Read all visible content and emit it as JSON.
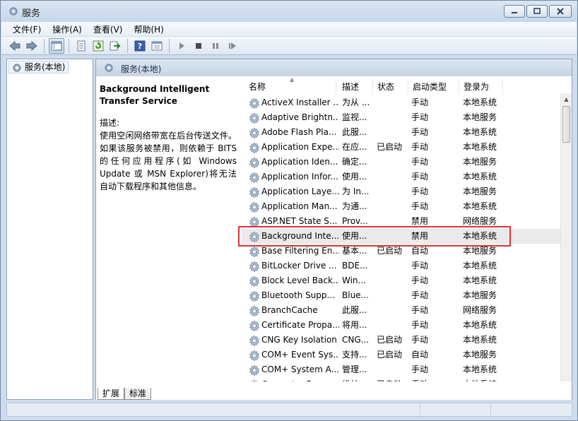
{
  "window": {
    "title": "服务"
  },
  "menu": [
    "文件(F)",
    "操作(A)",
    "查看(V)",
    "帮助(H)"
  ],
  "toolbar": {
    "icons": [
      "back-arrow-icon",
      "forward-arrow-icon",
      "show-tree-icon",
      "properties-icon",
      "refresh-icon",
      "export-icon",
      "help-icon",
      "view-icon",
      "start-icon",
      "stop-icon",
      "pause-icon",
      "restart-icon"
    ]
  },
  "tree": {
    "root": "服务(本地)"
  },
  "pane": {
    "header": "服务(本地)"
  },
  "description": {
    "title": "Background Intelligent Transfer Service",
    "label": "描述:",
    "body": "使用空闲网络带宽在后台传送文件。如果该服务被禁用，则依赖于 BITS 的任何应用程序(如 Windows Update 或 MSN Explorer)将无法自动下载程序和其他信息。"
  },
  "columns": {
    "name": "名称",
    "desc": "描述",
    "status": "状态",
    "startup": "启动类型",
    "logon": "登录为"
  },
  "services": [
    {
      "name": "ActiveX Installer ...",
      "desc": "为从 ...",
      "status": "",
      "startup": "手动",
      "logon": "本地系统"
    },
    {
      "name": "Adaptive Brightn...",
      "desc": "监视...",
      "status": "",
      "startup": "手动",
      "logon": "本地服务"
    },
    {
      "name": "Adobe Flash Pla...",
      "desc": "此服...",
      "status": "",
      "startup": "手动",
      "logon": "本地系统"
    },
    {
      "name": "Application Expe...",
      "desc": "在应...",
      "status": "已启动",
      "startup": "手动",
      "logon": "本地系统"
    },
    {
      "name": "Application Iden...",
      "desc": "确定...",
      "status": "",
      "startup": "手动",
      "logon": "本地服务"
    },
    {
      "name": "Application Infor...",
      "desc": "使用...",
      "status": "",
      "startup": "手动",
      "logon": "本地系统"
    },
    {
      "name": "Application Laye...",
      "desc": "为 In...",
      "status": "",
      "startup": "手动",
      "logon": "本地服务"
    },
    {
      "name": "Application Man...",
      "desc": "为通...",
      "status": "",
      "startup": "手动",
      "logon": "本地系统"
    },
    {
      "name": "ASP.NET State S...",
      "desc": "Prov...",
      "status": "",
      "startup": "禁用",
      "logon": "网络服务"
    },
    {
      "name": "Background Inte...",
      "desc": "使用...",
      "status": "",
      "startup": "禁用",
      "logon": "本地系统"
    },
    {
      "name": "Base Filtering En...",
      "desc": "基本...",
      "status": "已启动",
      "startup": "自动",
      "logon": "本地服务"
    },
    {
      "name": "BitLocker Drive ...",
      "desc": "BDE...",
      "status": "",
      "startup": "手动",
      "logon": "本地系统"
    },
    {
      "name": "Block Level Back...",
      "desc": "Win...",
      "status": "",
      "startup": "手动",
      "logon": "本地系统"
    },
    {
      "name": "Bluetooth Supp...",
      "desc": "Blue...",
      "status": "",
      "startup": "手动",
      "logon": "本地服务"
    },
    {
      "name": "BranchCache",
      "desc": "此服...",
      "status": "",
      "startup": "手动",
      "logon": "网络服务"
    },
    {
      "name": "Certificate Propa...",
      "desc": "将用...",
      "status": "",
      "startup": "手动",
      "logon": "本地系统"
    },
    {
      "name": "CNG Key Isolation",
      "desc": "CNG...",
      "status": "已启动",
      "startup": "手动",
      "logon": "本地系统"
    },
    {
      "name": "COM+ Event Sys...",
      "desc": "支持...",
      "status": "已启动",
      "startup": "自动",
      "logon": "本地服务"
    },
    {
      "name": "COM+ System A...",
      "desc": "管理...",
      "status": "",
      "startup": "手动",
      "logon": "本地系统"
    },
    {
      "name": "Computer Brow...",
      "desc": "维护...",
      "status": "已启动",
      "startup": "手动",
      "logon": "本地系统"
    }
  ],
  "selected_index": 9,
  "tabs": [
    "扩展",
    "标准"
  ],
  "colors": {
    "highlight": "#e03232",
    "selected_row": "#eaeaea"
  }
}
